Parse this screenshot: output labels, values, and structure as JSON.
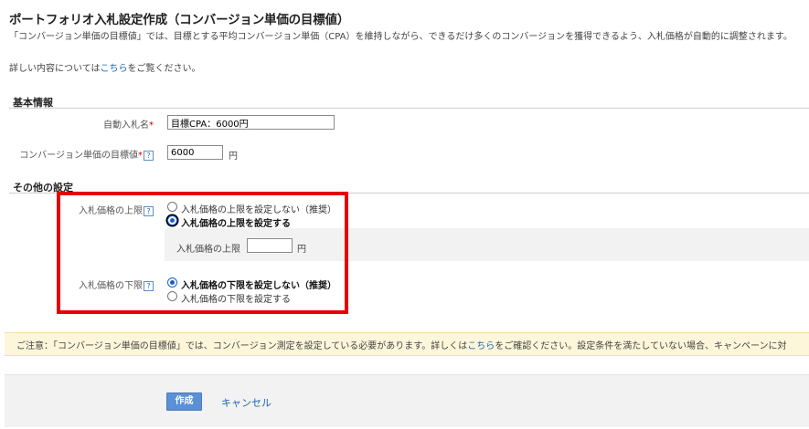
{
  "page": {
    "title": "ポートフォリオ入札設定作成（コンバージョン単価の目標値）",
    "intro": "「コンバージョン単価の目標値」では、目標とする平均コンバージョン単価（CPA）を維持しながら、できるだけ多くのコンバージョンを獲得できるよう、入札価格が自動的に調整されます。",
    "details_prefix": "詳しい内容については",
    "details_link": "こちら",
    "details_suffix": "をご覧ください。"
  },
  "basic": {
    "header": "基本情報",
    "name_label": "自動入札名",
    "name_value": "目標CPA：6000円",
    "cpa_label": "コンバージョン単価の目標値",
    "cpa_value": "6000",
    "cpa_unit": "円",
    "required_mark": "*",
    "help_glyph": "?"
  },
  "other": {
    "header": "その他の設定",
    "upper": {
      "label": "入札価格の上限",
      "options": [
        "入札価格の上限を設定しない（推奨）",
        "入札価格の上限を設定する"
      ],
      "selected_index": 1,
      "sub_label": "入札価格の上限",
      "sub_value": "",
      "sub_unit": "円"
    },
    "lower": {
      "label": "入札価格の下限",
      "options": [
        "入札価格の下限を設定しない（推奨）",
        "入札価格の下限を設定する"
      ],
      "selected_index": 0
    }
  },
  "notice": {
    "prefix": "ご注意：「コンバージョン単価の目標値」では、コンバージョン測定を設定している必要があります。詳しくは",
    "link": "こちら",
    "suffix": "をご確認ください。設定条件を満たしていない場合、キャンペーンに対"
  },
  "actions": {
    "create_label": "作成",
    "cancel_label": "キャンセル"
  },
  "colors": {
    "link": "#1a66b3",
    "highlight_border": "#e60000",
    "notice_bg": "#fdf6da",
    "primary_button": "#5b8fd6"
  }
}
